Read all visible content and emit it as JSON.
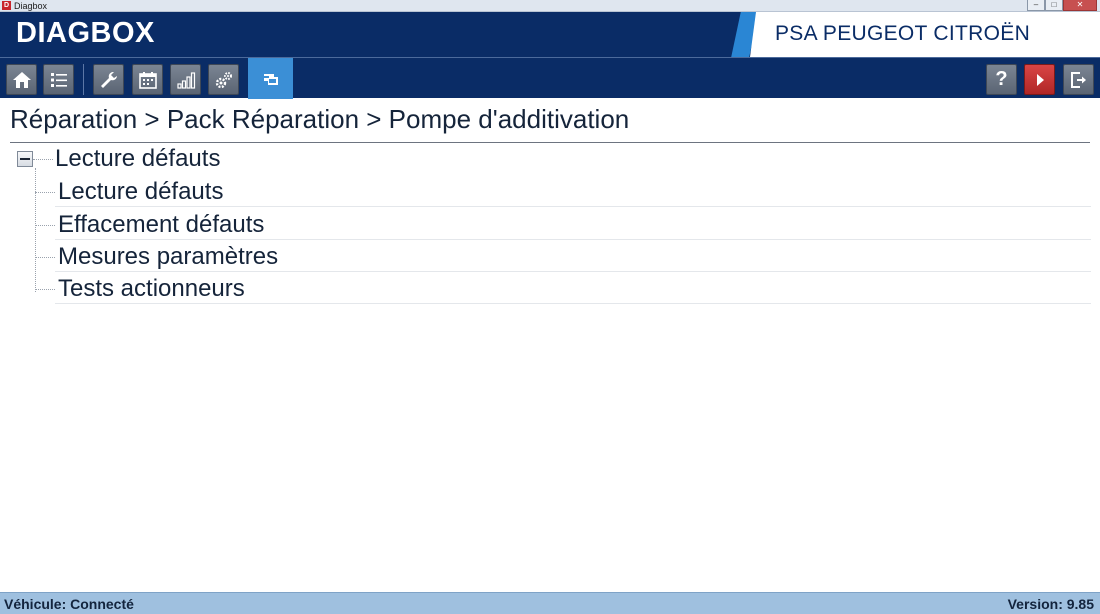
{
  "os_window": {
    "title": "Diagbox",
    "app_icon_letter": "D",
    "minimize_glyph": "–",
    "maximize_glyph": "□",
    "close_glyph": "✕"
  },
  "header": {
    "app_title": "DIAGBOX",
    "brand": "PSA PEUGEOT CITROËN",
    "colors": {
      "header_bg": "#0a2c66",
      "brand_stripe": "#2a86d4"
    }
  },
  "toolbar": {
    "left_buttons": [
      {
        "icon": "home-icon"
      },
      {
        "icon": "list-icon"
      },
      {
        "icon": "wrench-icon"
      },
      {
        "icon": "calendar-icon"
      },
      {
        "icon": "bar-chart-icon"
      },
      {
        "icon": "gears-icon"
      },
      {
        "icon": "vehicle-diagnostic-icon",
        "active": true
      }
    ],
    "right_buttons": [
      {
        "icon": "help-icon",
        "glyph": "?"
      },
      {
        "icon": "play-icon"
      },
      {
        "icon": "exit-icon"
      }
    ],
    "colors": {
      "active_bg": "#3b8fd6",
      "danger": "#c0302f"
    }
  },
  "breadcrumb": {
    "text": "Réparation > Pack Réparation > Pompe d'additivation"
  },
  "tree": {
    "root": {
      "label": "Lecture défauts",
      "expanded": true
    },
    "children": [
      {
        "label": "Lecture défauts"
      },
      {
        "label": "Effacement défauts"
      },
      {
        "label": "Mesures paramètres"
      },
      {
        "label": "Tests actionneurs"
      }
    ]
  },
  "statusbar": {
    "left": "Véhicule: Connecté",
    "right": "Version: 9.85"
  }
}
